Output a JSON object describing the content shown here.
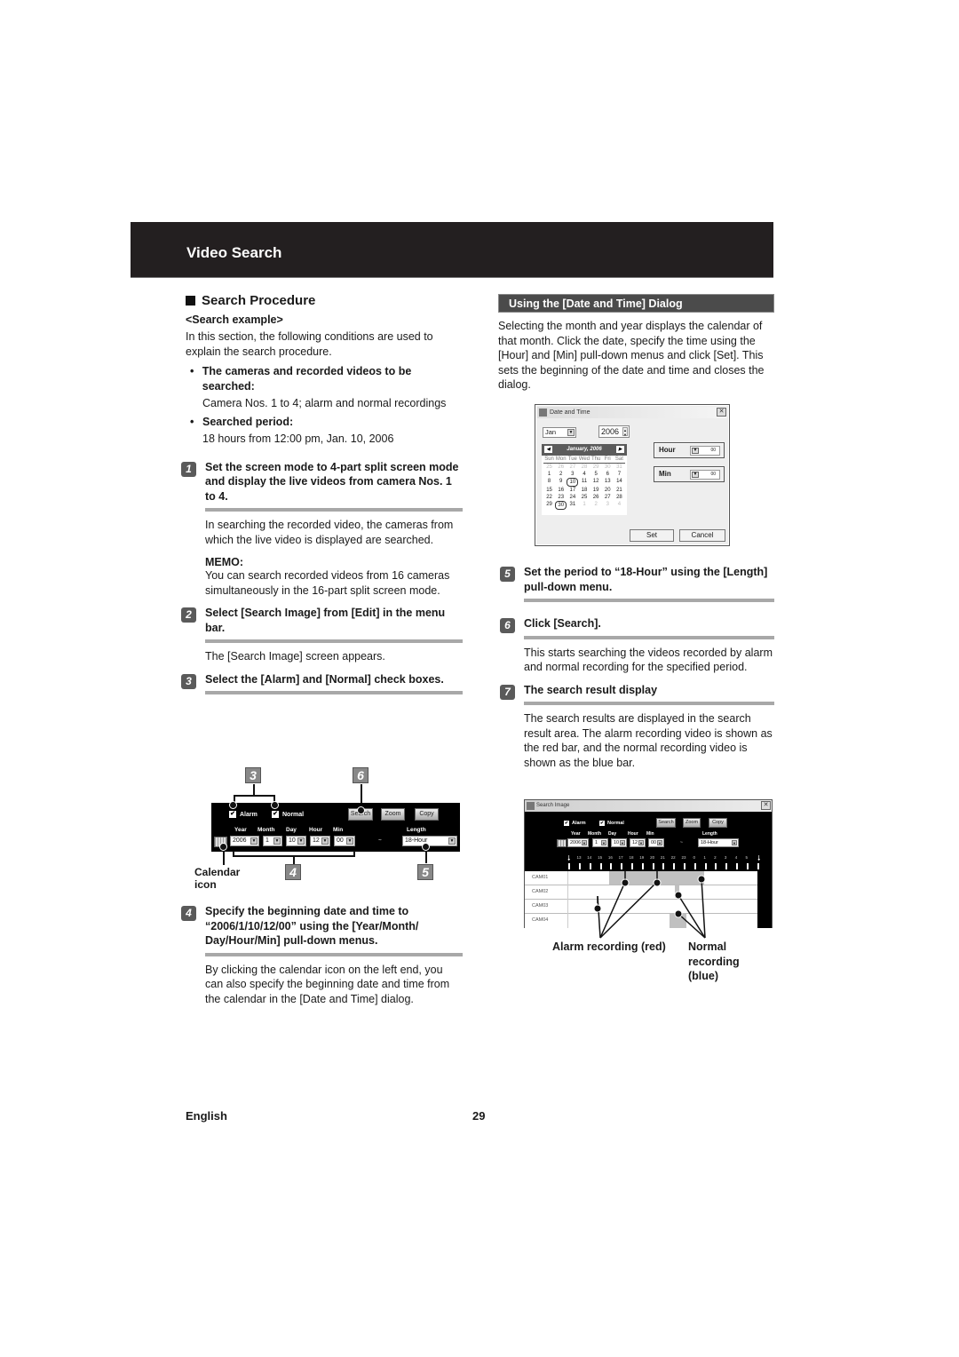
{
  "header": {
    "title": "Video Search"
  },
  "left": {
    "section_title": "Search Procedure",
    "example_title": "<Search example>",
    "intro": "In this section, the following conditions are used to explain the search procedure.",
    "bullets": [
      {
        "label": "The cameras and recorded videos to be searched:",
        "text": "Camera Nos. 1 to 4; alarm and normal recordings"
      },
      {
        "label": "Searched period:",
        "text": "18 hours from 12:00 pm, Jan. 10, 2006"
      }
    ],
    "steps": [
      {
        "num": "1",
        "title": "Set the screen mode to 4-part split screen mode and display the live videos from camera Nos. 1 to 4.",
        "text": "In searching the recorded video, the cameras from which the live video is displayed are searched.",
        "memo_label": "MEMO:",
        "memo": "You can search recorded videos from 16 cameras simultaneously in the 16-part split screen mode."
      },
      {
        "num": "2",
        "title": "Select [Search Image] from [Edit] in the menu bar.",
        "text": "The [Search Image] screen appears."
      },
      {
        "num": "3",
        "title": "Select the [Alarm] and [Normal] check boxes."
      },
      {
        "num": "4",
        "title": "Specify the beginning date and time to “2006/1/10/12/00” using the [Year/Month/ Day/Hour/Min] pull-down menus.",
        "text": "By clicking the calendar icon on the left end, you can also specify the beginning date and time from the calendar in the [Date and Time] dialog."
      }
    ]
  },
  "toolbar_figure": {
    "callouts": [
      "3",
      "6",
      "4",
      "5"
    ],
    "alarm_label": "Alarm",
    "normal_label": "Normal",
    "search_btn": "Search",
    "zoom_btn": "Zoom",
    "copy_btn": "Copy",
    "labels": {
      "year": "Year",
      "month": "Month",
      "day": "Day",
      "hour": "Hour",
      "min": "Min",
      "length": "Length"
    },
    "values": {
      "year": "2006",
      "month": "1",
      "day": "10",
      "hour": "12",
      "min": "00",
      "tilde": "~",
      "length": "18-Hour"
    },
    "calendar_label": "Calendar icon"
  },
  "right": {
    "subheading": "Using the [Date and Time] Dialog",
    "intro": "Selecting the month and year displays the calendar of that month. Click the date, specify the time using the [Hour] and [Min] pull-down menus and click [Set]. This sets the beginning of the date and time and closes the dialog.",
    "steps": [
      {
        "num": "5",
        "title": "Set the period to “18-Hour” using the [Length] pull-down menu."
      },
      {
        "num": "6",
        "title": "Click [Search].",
        "text": "This starts searching the videos recorded by alarm and normal recording for the specified period."
      },
      {
        "num": "7",
        "title": "The search result display",
        "text": "The search results are displayed in the search result area. The alarm recording video is shown as the red bar, and the normal recording video is shown as the blue bar."
      }
    ]
  },
  "dialog": {
    "title": "Date and Time",
    "month": "Jan",
    "year": "2006",
    "calendar_header": "January, 2006",
    "weekdays": [
      "Sun",
      "Mon",
      "Tue",
      "Wed",
      "Thu",
      "Fri",
      "Sat"
    ],
    "days": [
      [
        "25",
        "26",
        "27",
        "28",
        "29",
        "30",
        "31"
      ],
      [
        "1",
        "2",
        "3",
        "4",
        "5",
        "6",
        "7"
      ],
      [
        "8",
        "9",
        "10",
        "11",
        "12",
        "13",
        "14"
      ],
      [
        "15",
        "16",
        "17",
        "18",
        "19",
        "20",
        "21"
      ],
      [
        "22",
        "23",
        "24",
        "25",
        "26",
        "27",
        "28"
      ],
      [
        "29",
        "30",
        "31",
        "1",
        "2",
        "3",
        "4"
      ]
    ],
    "selected_day": "10",
    "today_day": "30",
    "hour_label": "Hour",
    "hour_value": "00",
    "min_label": "Min",
    "min_value": "00",
    "set_btn": "Set",
    "cancel_btn": "Cancel"
  },
  "search_image": {
    "title": "Search Image",
    "alarm_label": "Alarm",
    "normal_label": "Normal",
    "search_btn": "Search",
    "zoom_btn": "Zoom",
    "copy_btn": "Copy",
    "labels": {
      "year": "Year",
      "month": "Month",
      "day": "Day",
      "hour": "Hour",
      "min": "Min",
      "length": "Length"
    },
    "values": {
      "year": "2006",
      "month": "1",
      "day": "10",
      "hour": "12",
      "min": "00",
      "tilde": "~",
      "length": "18-Hour"
    },
    "hours": [
      "13",
      "14",
      "15",
      "16",
      "17",
      "18",
      "19",
      "20",
      "21",
      "22",
      "23",
      "0",
      "1",
      "2",
      "3",
      "4",
      "5"
    ],
    "cameras": [
      "CAM01",
      "CAM02",
      "CAM03",
      "CAM04"
    ],
    "alarm_label_caption": "Alarm recording (red)",
    "normal_label_caption": "Normal recording (blue)"
  },
  "footer": {
    "language": "English",
    "page": "29"
  }
}
